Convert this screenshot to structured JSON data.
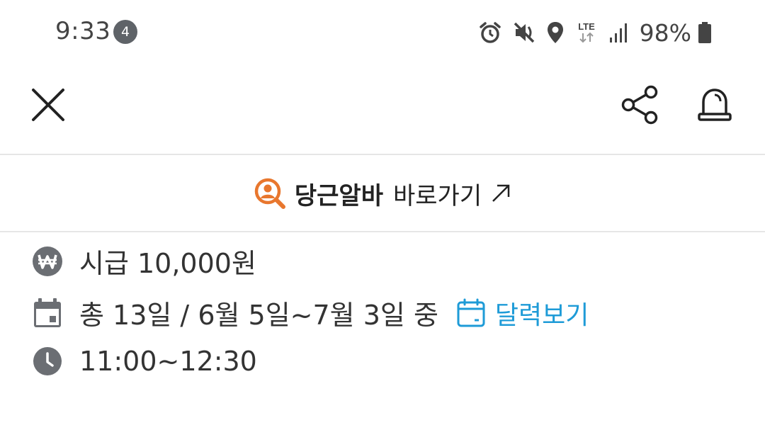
{
  "status_bar": {
    "time": "9:33",
    "notification_count": "4",
    "network": "LTE",
    "battery": "98%"
  },
  "toolbar": {
    "close_icon": "close-icon",
    "share_icon": "share-icon",
    "report_icon": "siren-icon"
  },
  "promo": {
    "brand": "당근알바",
    "text": "바로가기",
    "arrow": "↗",
    "brand_color": "#e8772e"
  },
  "job": {
    "wage": "시급 10,000원",
    "schedule": "총 13일 / 6월 5일~7월 3일 중",
    "calendar_link": "달력보기",
    "hours": "11:00~12:30"
  },
  "colors": {
    "accent_blue": "#1e9bd7",
    "icon_gray": "#6b6e73"
  }
}
